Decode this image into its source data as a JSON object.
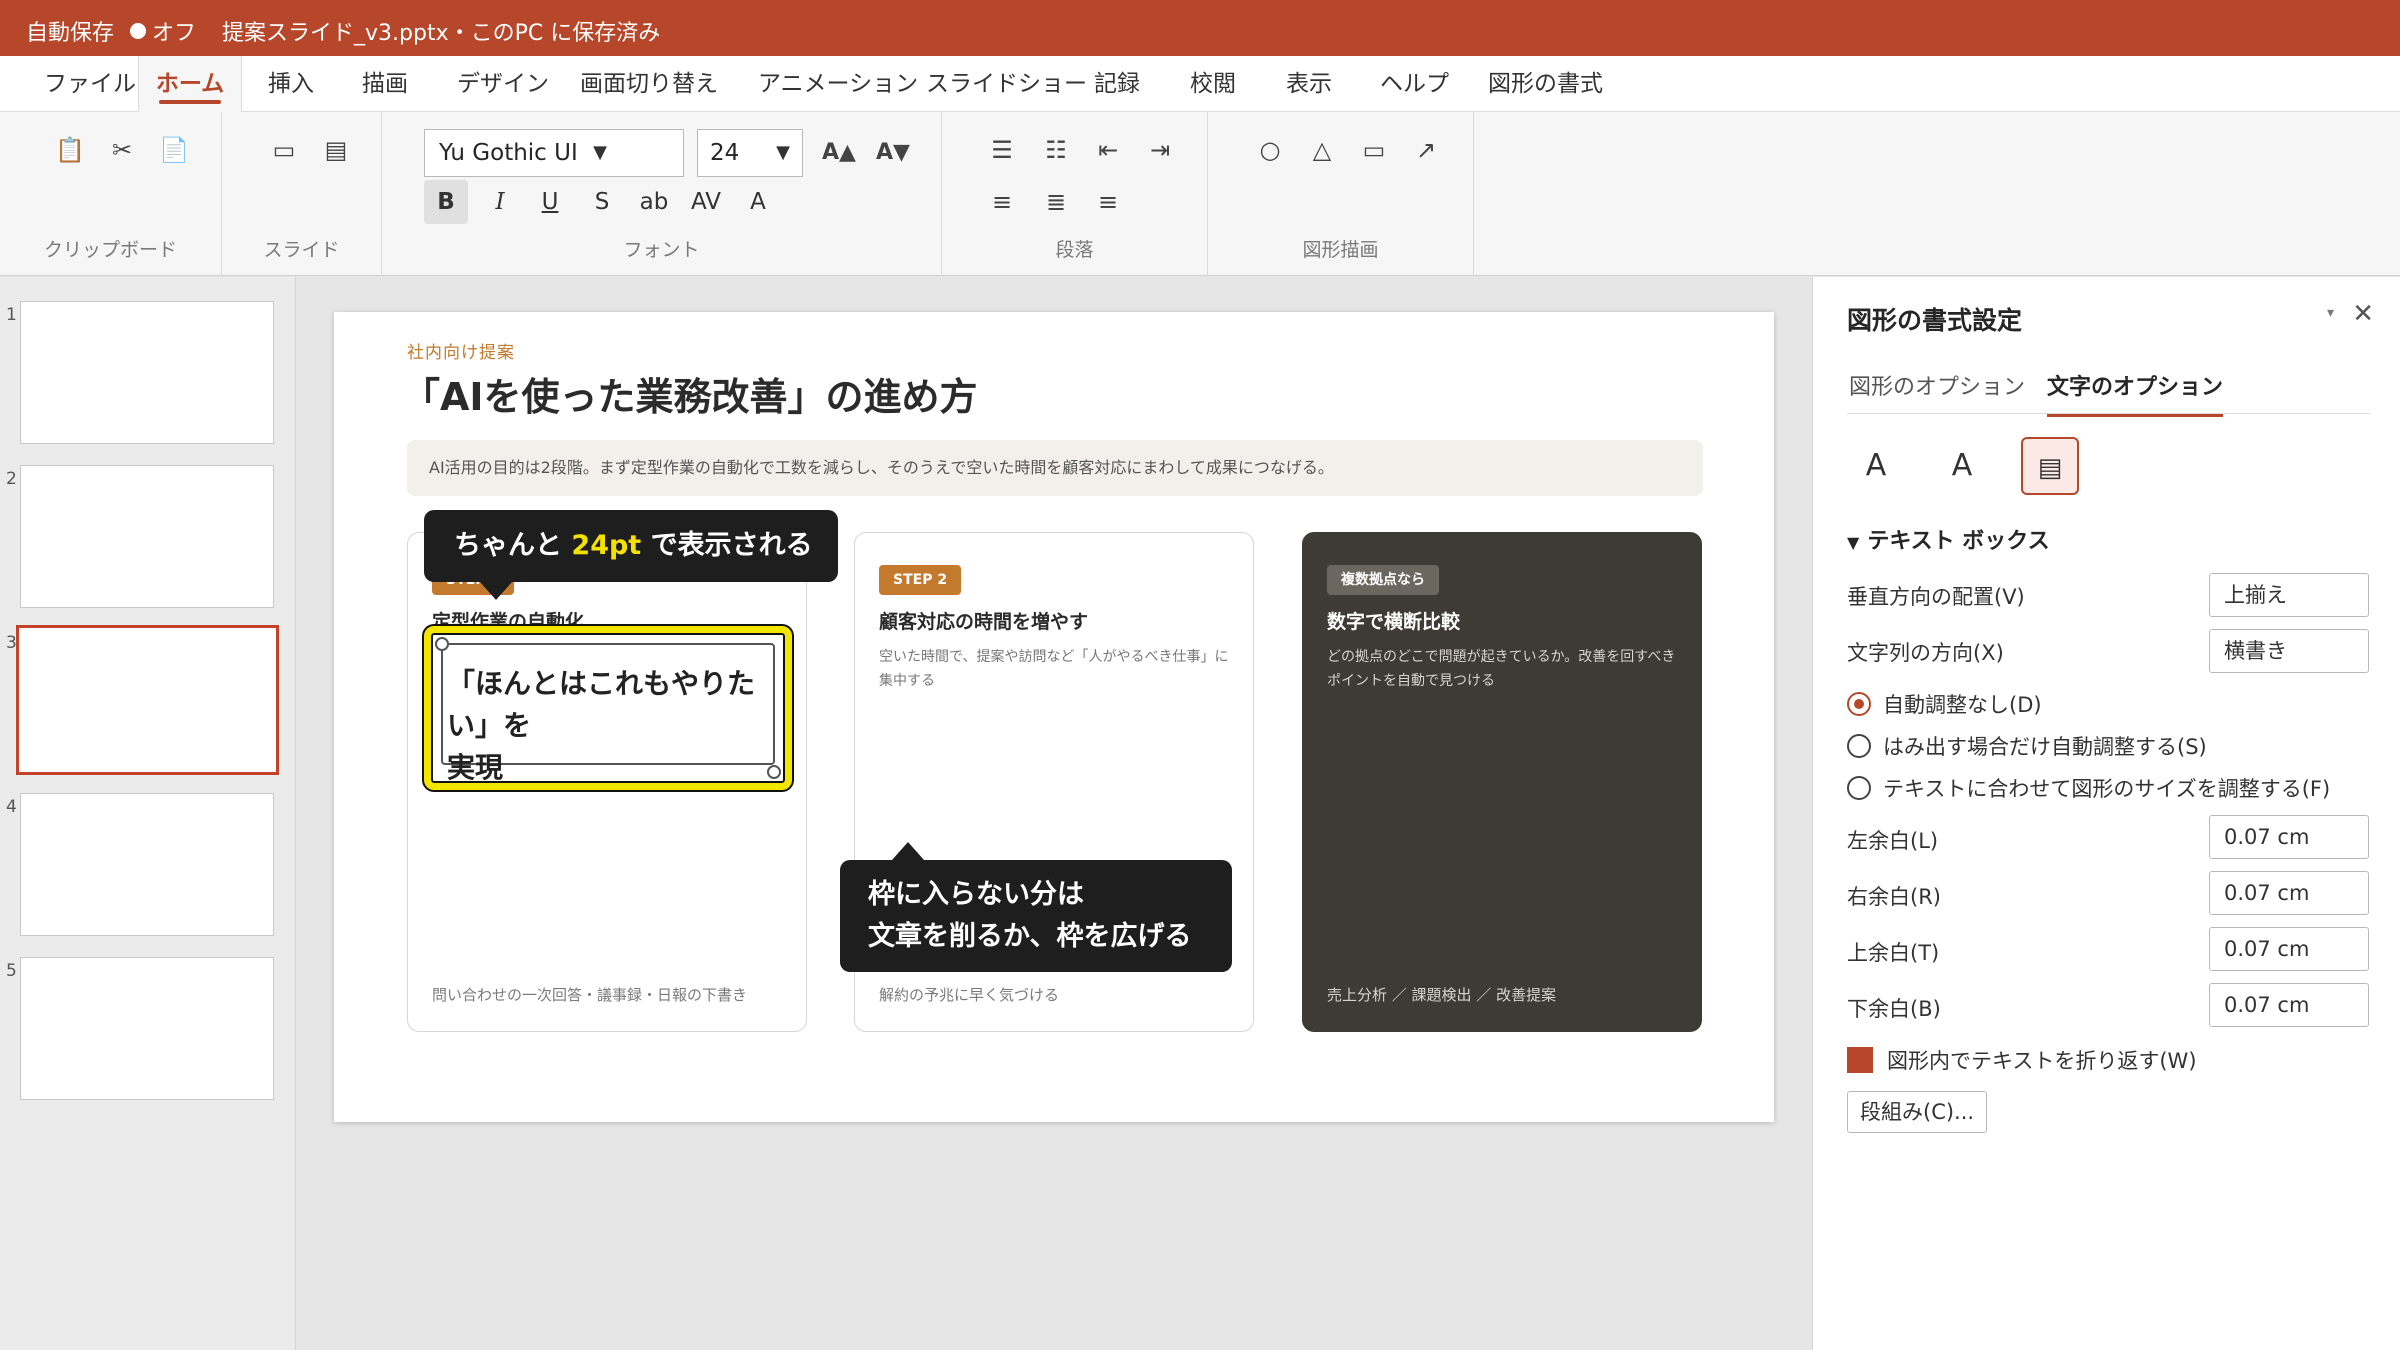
{
  "titlebar": {
    "autosave": "自動保存",
    "autosave_state": "オフ",
    "document": "提案スライド_v3.pptx・このPC に保存済み"
  },
  "menu": {
    "tabs": [
      "ファイル",
      "ホーム",
      "挿入",
      "描画",
      "デザイン",
      "画面切り替え",
      "アニメーション",
      "スライドショー",
      "記録",
      "校閲",
      "表示",
      "ヘルプ",
      "図形の書式"
    ],
    "active": "ホーム"
  },
  "ribbon": {
    "groups": {
      "clipboard": "クリップボード",
      "slides": "スライド",
      "font": "フォント",
      "paragraph": "段落",
      "drawing": "図形描画"
    },
    "font_name": "Yu Gothic UI",
    "font_size": "24",
    "grow_font": "A▲",
    "shrink_font": "A▼",
    "format_buttons": [
      "B",
      "I",
      "U",
      "S",
      "ab",
      "AV",
      "A"
    ]
  },
  "thumbnails": [
    "1",
    "2",
    "3",
    "4",
    "5"
  ],
  "active_slide": "3",
  "slide": {
    "kicker": "社内向け提案",
    "title": "「AIを使った業務改善」の進め方",
    "summary": "AI活用の目的は2段階。まず定型作業の自動化で工数を減らし、そのうえで空いた時間を顧客対応にまわして成果につなげる。",
    "cards": [
      {
        "badge": "STEP 1",
        "title": "定型作業の自動化",
        "body": "",
        "footer": "問い合わせの一次回答・議事録・日報の下書き"
      },
      {
        "badge": "STEP 2",
        "title": "顧客対応の時間を増やす",
        "body": "空いた時間で、提案や訪問など「人がやるべき仕事」に集中する",
        "footer": "解約の予兆に早く気づける"
      },
      {
        "badge": "複数拠点なら",
        "title": "数字で横断比較",
        "body": "どの拠点のどこで問題が起きているか。改善を回すべきポイントを自動で見つける",
        "footer": "売上分析 ／ 課題検出 ／ 改善提案"
      }
    ],
    "textbox_text_line1": "「ほんとはこれもやりたい」を",
    "textbox_text_line2": "実現",
    "callout1_pre": "ちゃんと ",
    "callout1_highlight": "24pt",
    "callout1_post": " で表示される",
    "callout2_line1": "枠に入らない分は",
    "callout2_line2": "文章を削るか、枠を広げる"
  },
  "pane": {
    "title": "図形の書式設定",
    "tabs": [
      "図形のオプション",
      "文字のオプション"
    ],
    "active_tab": "文字のオプション",
    "icons": [
      "A",
      "A",
      "▤"
    ],
    "section": "テキスト ボックス",
    "vertical_align_label": "垂直方向の配置(V)",
    "vertical_align_value": "上揃え",
    "text_direction_label": "文字列の方向(X)",
    "text_direction_value": "横書き",
    "autofit_options": [
      "自動調整なし(D)",
      "はみ出す場合だけ自動調整する(S)",
      "テキストに合わせて図形のサイズを調整する(F)"
    ],
    "autofit_selected": 0,
    "margins": [
      {
        "label": "左余白(L)",
        "value": "0.07 cm"
      },
      {
        "label": "右余白(R)",
        "value": "0.07 cm"
      },
      {
        "label": "上余白(T)",
        "value": "0.07 cm"
      },
      {
        "label": "下余白(B)",
        "value": "0.07 cm"
      }
    ],
    "wrap_label": "図形内でテキストを折り返す(W)",
    "wrap_checked": true,
    "columns_button": "段組み(C)..."
  }
}
